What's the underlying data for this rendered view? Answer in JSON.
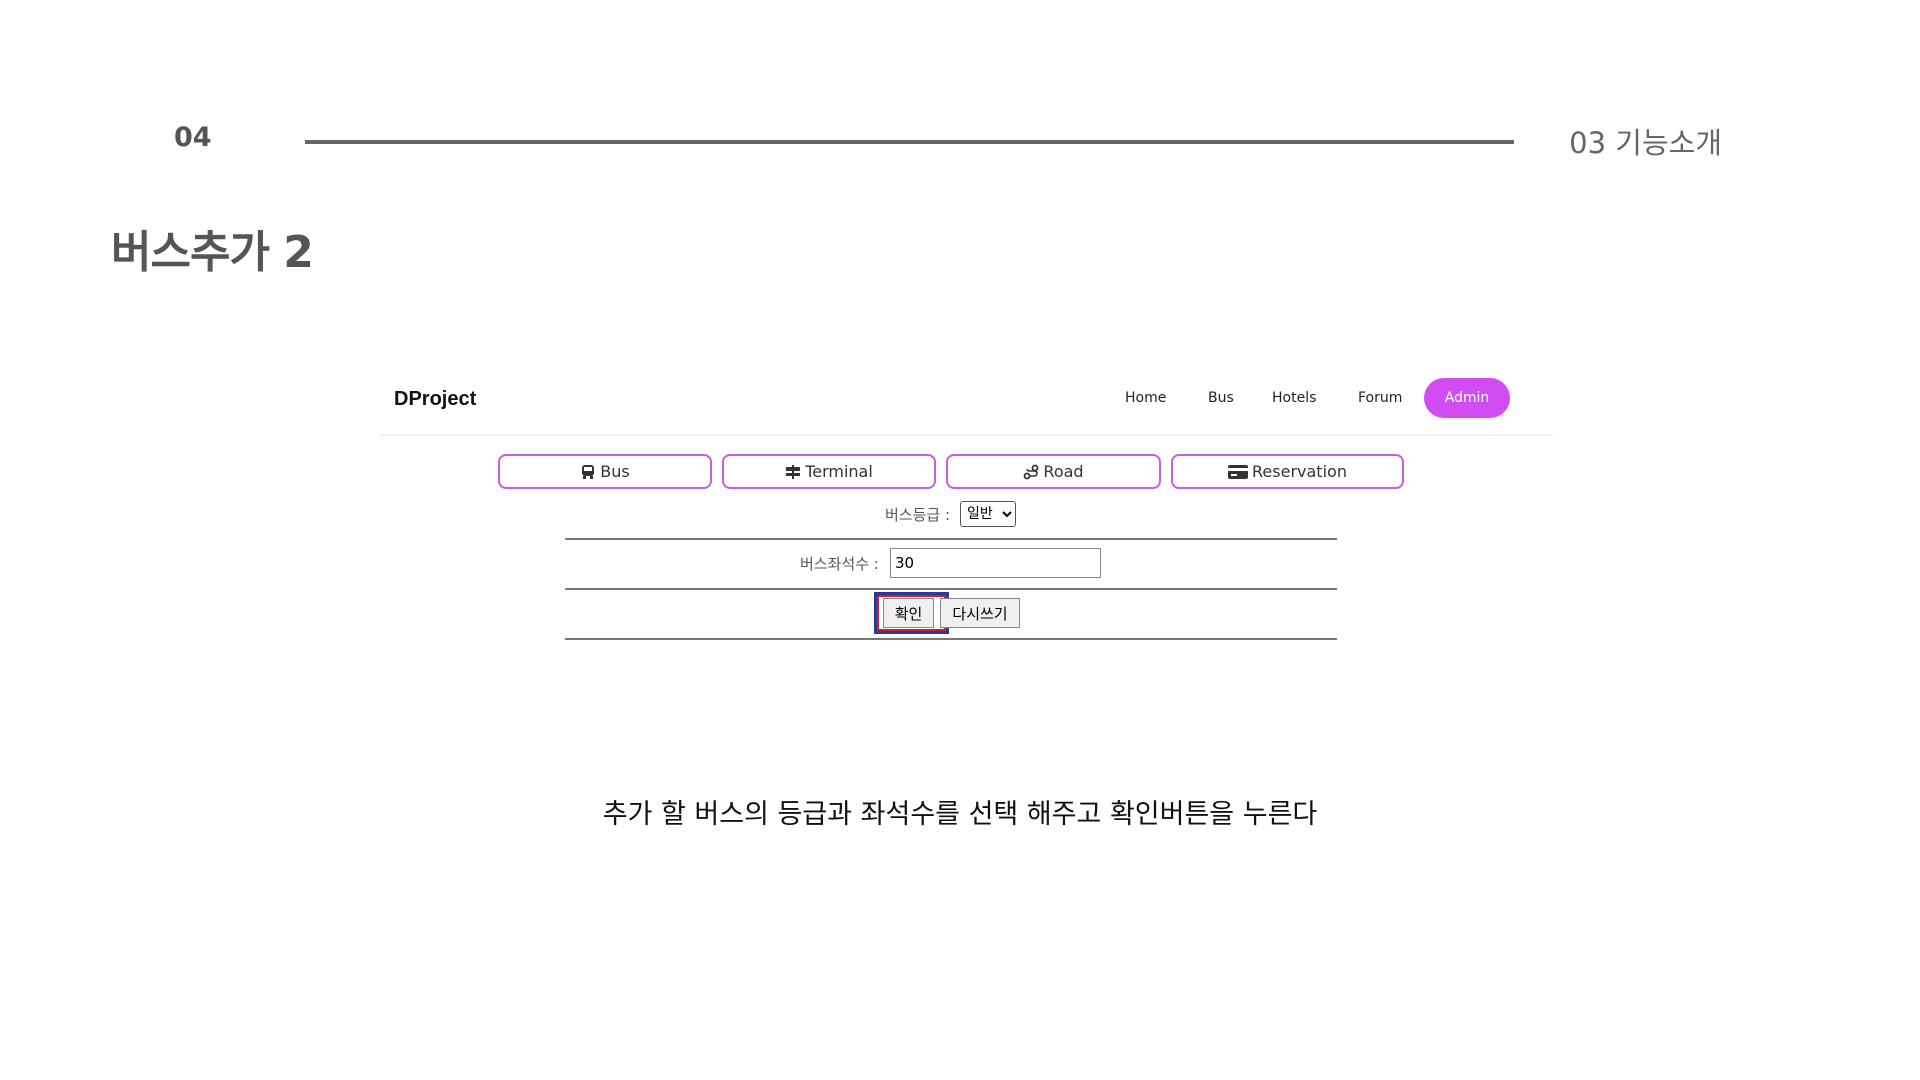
{
  "slide": {
    "page_number": "04",
    "section_label": "03 기능소개",
    "title": "버스추가 2",
    "caption": "추가 할 버스의 등급과 좌석수를 선택 해주고 확인버튼을 누른다"
  },
  "app": {
    "brand": "DProject",
    "nav": {
      "home": "Home",
      "bus": "Bus",
      "hotels": "Hotels",
      "forum": "Forum",
      "admin": "Admin"
    },
    "tabs": {
      "bus": "Bus",
      "terminal": "Terminal",
      "road": "Road",
      "reservation": "Reservation"
    },
    "form": {
      "grade_label": "버스등급 :",
      "grade_selected": "일반",
      "seats_label": "버스좌석수 :",
      "seats_value": "30",
      "confirm_label": "확인",
      "reset_label": "다시쓰기"
    }
  },
  "colors": {
    "accent": "#d14cf2",
    "tab_border": "#c35ee6",
    "highlight_outer": "#2c3a8f",
    "highlight_inner": "#c4203a"
  }
}
